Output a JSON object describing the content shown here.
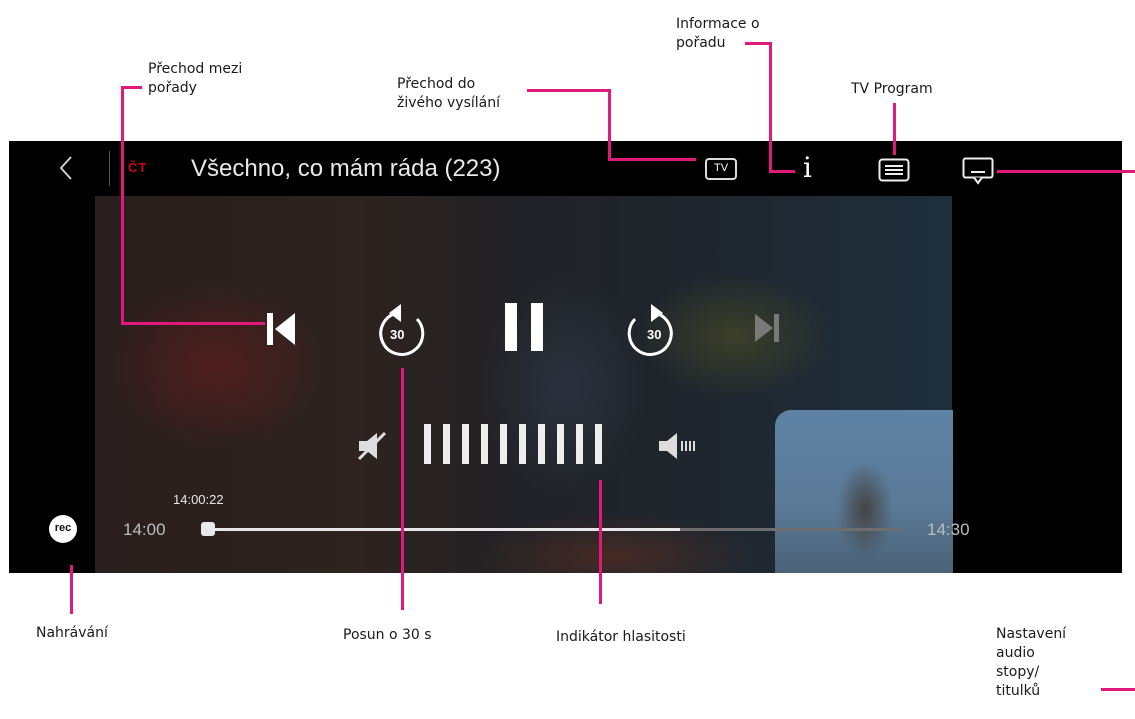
{
  "annotations": {
    "program_switch": "Přechod mezi\npořady",
    "go_live": "Přechod do\nživého vysílání",
    "program_info": "Informace o\npořadu",
    "tv_program": "TV Program",
    "recording": "Nahrávání",
    "skip_30": "Posun o 30 s",
    "volume_indicator": "Indikátor hlasitosti",
    "audio_subtitles": "Nastavení\naudio\nstopy/\ntitulků"
  },
  "player": {
    "channel_logo": "ČT",
    "title": "Všechno, co mám ráda (223)",
    "tv_badge": "TV",
    "info_glyph": "i",
    "rewind_label": "30",
    "forward_label": "30",
    "current_time": "14:00:22",
    "start_time": "14:00",
    "end_time": "14:30",
    "rec_label": "rec",
    "progress_fraction": 0.68,
    "volume_level_bars": 10
  },
  "colors": {
    "accent_leader": "#e0197a",
    "channel_logo": "#d0021b"
  },
  "icons": [
    "back-icon",
    "channel-logo",
    "tv-live-icon",
    "info-icon",
    "tv-program-icon",
    "subtitles-icon",
    "previous-icon",
    "rewind-30-icon",
    "pause-icon",
    "forward-30-icon",
    "next-icon",
    "mute-icon",
    "volume-icon",
    "rec-icon"
  ]
}
